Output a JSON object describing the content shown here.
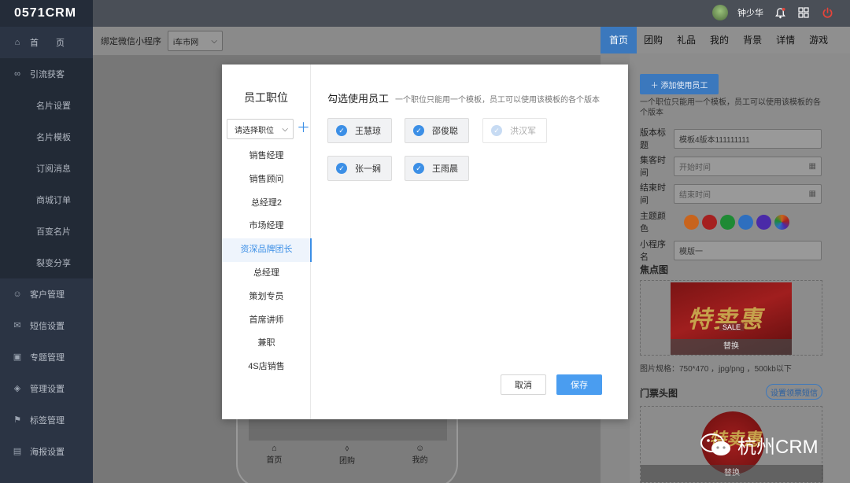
{
  "app": {
    "logo": "0571CRM"
  },
  "sidebar": {
    "items": [
      {
        "label": "首　　页",
        "icon": "home-icon"
      },
      {
        "label": "引流获客",
        "icon": "share-icon"
      },
      {
        "label": "名片设置"
      },
      {
        "label": "名片模板"
      },
      {
        "label": "订阅消息"
      },
      {
        "label": "商城订单"
      },
      {
        "label": "百变名片"
      },
      {
        "label": "裂变分享"
      },
      {
        "label": "客户管理",
        "icon": "user-icon"
      },
      {
        "label": "短信设置",
        "icon": "mail-icon"
      },
      {
        "label": "专题管理",
        "icon": "doc-icon"
      },
      {
        "label": "管理设置",
        "icon": "layers-icon"
      },
      {
        "label": "标签管理",
        "icon": "bookmark-icon"
      },
      {
        "label": "海报设置",
        "icon": "image-icon"
      }
    ]
  },
  "header": {
    "username": "钟少华"
  },
  "filter": {
    "label": "绑定微信小程序",
    "value": "i车市网"
  },
  "tabs": [
    "首页",
    "团购",
    "礼品",
    "我的",
    "背景",
    "详情",
    "游戏"
  ],
  "phone_nav": [
    "首页",
    "团购",
    "我的"
  ],
  "right_panel": {
    "add_button": "＋ 添加使用员工",
    "note": "一个职位只能用一个模板，员工可以使用该模板的各个版本",
    "version_title_label": "版本标题",
    "version_title_value": "模板4版本111111111",
    "start_label": "集客时间",
    "start_placeholder": "开始时间",
    "end_label": "结束时间",
    "end_placeholder": "结束时间",
    "theme_label": "主题颜色",
    "theme_colors": [
      "#c8641d",
      "#a52020",
      "#1e8a34",
      "#2e6fbf",
      "#4a2aa8",
      "multi"
    ],
    "mini_label": "小程序名",
    "mini_value": "模版一",
    "focus_title": "焦点图",
    "banner_text": "特卖惠",
    "banner_sale": "SALE",
    "swap_label": "替换",
    "spec": "图片规格：750*470 ，jpg/png ，500kb以下",
    "ticket_title": "门票头图",
    "sms_button": "设置领票短信",
    "swap_label2": "替换"
  },
  "watermark": {
    "text": "杭州CRM"
  },
  "modal": {
    "left_title": "员工职位",
    "select_placeholder": "请选择职位",
    "positions": [
      "销售经理",
      "销售顾问",
      "总经理2",
      "市场经理",
      "资深品牌团长",
      "总经理",
      "策划专员",
      "首席讲师",
      "兼职",
      "4S店销售"
    ],
    "active_index": 4,
    "right_title": "勾选使用员工",
    "right_subtitle": "一个职位只能用一个模板，员工可以使用该模板的各个版本",
    "employees": [
      {
        "name": "王慧琼",
        "checked": true,
        "disabled": false
      },
      {
        "name": "邵俊聪",
        "checked": true,
        "disabled": false
      },
      {
        "name": "洪汉军",
        "checked": true,
        "disabled": true
      },
      {
        "name": "张一娴",
        "checked": true,
        "disabled": false
      },
      {
        "name": "王雨晨",
        "checked": true,
        "disabled": false
      }
    ],
    "cancel": "取消",
    "save": "保存"
  }
}
